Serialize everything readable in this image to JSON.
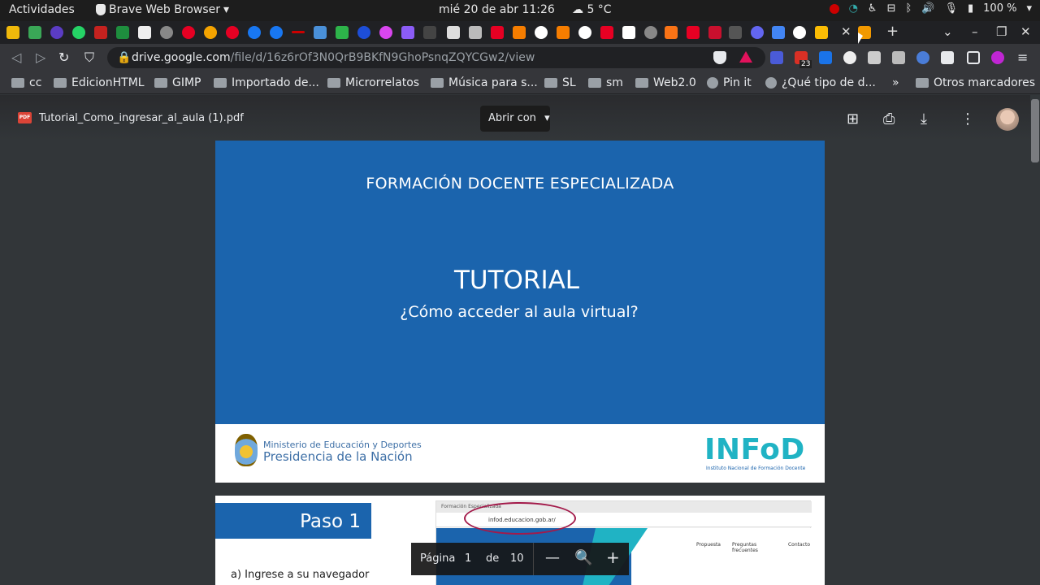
{
  "system_bar": {
    "activities": "Actividades",
    "app_name": "Brave Web Browser",
    "clock": "mié 20 de abr  11:26",
    "weather": "5 °C",
    "battery": "100 %"
  },
  "browser": {
    "url_host": "drive.google.com",
    "url_path": "/file/d/16z6rOf3N0QrB9BKfN9GhoPsnqZQYCGw2/view",
    "new_tab": "+",
    "ext_badge": "23"
  },
  "bookmarks": [
    {
      "label": "cc"
    },
    {
      "label": "EdicionHTML"
    },
    {
      "label": "GIMP"
    },
    {
      "label": "Importado de..."
    },
    {
      "label": "Microrrelatos"
    },
    {
      "label": "Música para s..."
    },
    {
      "label": "SL"
    },
    {
      "label": "sm"
    },
    {
      "label": "Web2.0"
    },
    {
      "label": "Pin it"
    },
    {
      "label": "¿Qué tipo de d..."
    },
    {
      "label": "Otros marcadores"
    }
  ],
  "bookmarks_more": "»",
  "viewer": {
    "pdf_badge": "PDF",
    "filename": "Tutorial_Como_ingresar_al_aula (1).pdf",
    "open_with": "Abrir con"
  },
  "page1": {
    "heading": "FORMACIÓN DOCENTE ESPECIALIZADA",
    "title": "TUTORIAL",
    "question": "¿Cómo acceder al aula virtual?",
    "ministry_line1": "Ministerio de Educación y Deportes",
    "ministry_line2": "Presidencia de la Nación",
    "infod": "INFoD",
    "infod_sub": "Instituto Nacional de Formación Docente"
  },
  "page2": {
    "step_title": "Paso 1",
    "step_text": "a)   Ingrese a su navegador",
    "shot_tab": "Formación Especializada",
    "shot_url": "infod.educacion.gob.ar/",
    "shot_nav": [
      "Propuesta",
      "Preguntas frecuentes",
      "Contacto"
    ]
  },
  "pager": {
    "label": "Página",
    "current": "1",
    "of": "de",
    "total": "10"
  },
  "colors": {
    "slide_blue": "#1b64ad",
    "infod_teal": "#20b3c4",
    "highlight": "#a31a4a"
  }
}
